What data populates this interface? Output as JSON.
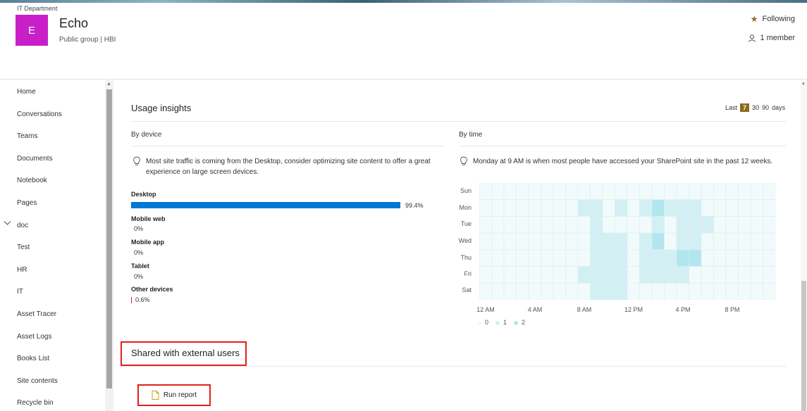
{
  "header": {
    "hub": "IT Department",
    "logo_letter": "E",
    "title": "Echo",
    "subtitle": "Public group | HBI",
    "following": "Following",
    "members": "1 member"
  },
  "nav": {
    "items": [
      "Home",
      "Conversations",
      "Teams",
      "Documents",
      "Notebook",
      "Pages",
      "doc",
      "Test",
      "HR",
      "IT",
      "Asset Tracer",
      "Asset Logs",
      "Books List",
      "Site contents",
      "Recycle bin"
    ]
  },
  "insights": {
    "title": "Usage insights",
    "range_prefix": "Last",
    "range_options": [
      "7",
      "30",
      "90"
    ],
    "range_selected": "7",
    "range_suffix": "days",
    "by_device": {
      "heading": "By device",
      "tip": "Most site traffic is coming from the Desktop, consider optimizing site content to offer a great experience on large screen devices.",
      "devices": [
        {
          "name": "Desktop",
          "value": "99.4%",
          "percent": 99.4
        },
        {
          "name": "Mobile web",
          "value": "0%",
          "percent": 0
        },
        {
          "name": "Mobile app",
          "value": "0%",
          "percent": 0
        },
        {
          "name": "Tablet",
          "value": "0%",
          "percent": 0
        },
        {
          "name": "Other devices",
          "value": "0.6%",
          "percent": 0.6
        }
      ]
    },
    "by_time": {
      "heading": "By time",
      "tip": "Monday at 9 AM is when most people have accessed your SharePoint site in the past 12 weeks.",
      "days": [
        "Sun",
        "Mon",
        "Tue",
        "Wed",
        "Thu",
        "Fri",
        "Sat"
      ],
      "hour_labels": [
        "12 AM",
        "4 AM",
        "8 AM",
        "12 PM",
        "4 PM",
        "8 PM"
      ],
      "legend": [
        "0",
        "1",
        "2"
      ],
      "colors": [
        "#f1fbfc",
        "#d2f0f4",
        "#b2e6ee"
      ],
      "cells": [
        [
          0,
          0,
          0,
          0,
          0,
          0,
          0,
          0,
          0,
          0,
          0,
          0,
          0,
          0,
          0,
          0,
          0,
          0,
          0,
          0,
          0,
          0,
          0,
          0
        ],
        [
          0,
          0,
          0,
          0,
          0,
          0,
          0,
          0,
          1,
          1,
          0,
          1,
          0,
          1,
          2,
          1,
          1,
          1,
          0,
          0,
          0,
          0,
          0,
          0
        ],
        [
          0,
          0,
          0,
          0,
          0,
          0,
          0,
          0,
          0,
          1,
          0,
          0,
          0,
          0,
          1,
          0,
          1,
          1,
          1,
          0,
          0,
          0,
          0,
          0
        ],
        [
          0,
          0,
          0,
          0,
          0,
          0,
          0,
          0,
          0,
          1,
          1,
          1,
          0,
          1,
          2,
          0,
          1,
          1,
          0,
          0,
          0,
          0,
          0,
          0
        ],
        [
          0,
          0,
          0,
          0,
          0,
          0,
          0,
          0,
          0,
          1,
          1,
          1,
          0,
          1,
          1,
          1,
          2,
          2,
          0,
          0,
          0,
          0,
          0,
          0
        ],
        [
          0,
          0,
          0,
          0,
          0,
          0,
          0,
          0,
          1,
          1,
          1,
          1,
          0,
          1,
          1,
          1,
          1,
          0,
          0,
          0,
          0,
          0,
          0,
          0
        ],
        [
          0,
          0,
          0,
          0,
          0,
          0,
          0,
          0,
          0,
          1,
          1,
          1,
          0,
          0,
          0,
          0,
          0,
          0,
          0,
          0,
          0,
          0,
          0,
          0
        ]
      ]
    }
  },
  "shared": {
    "title": "Shared with external users",
    "run_report": "Run report"
  }
}
